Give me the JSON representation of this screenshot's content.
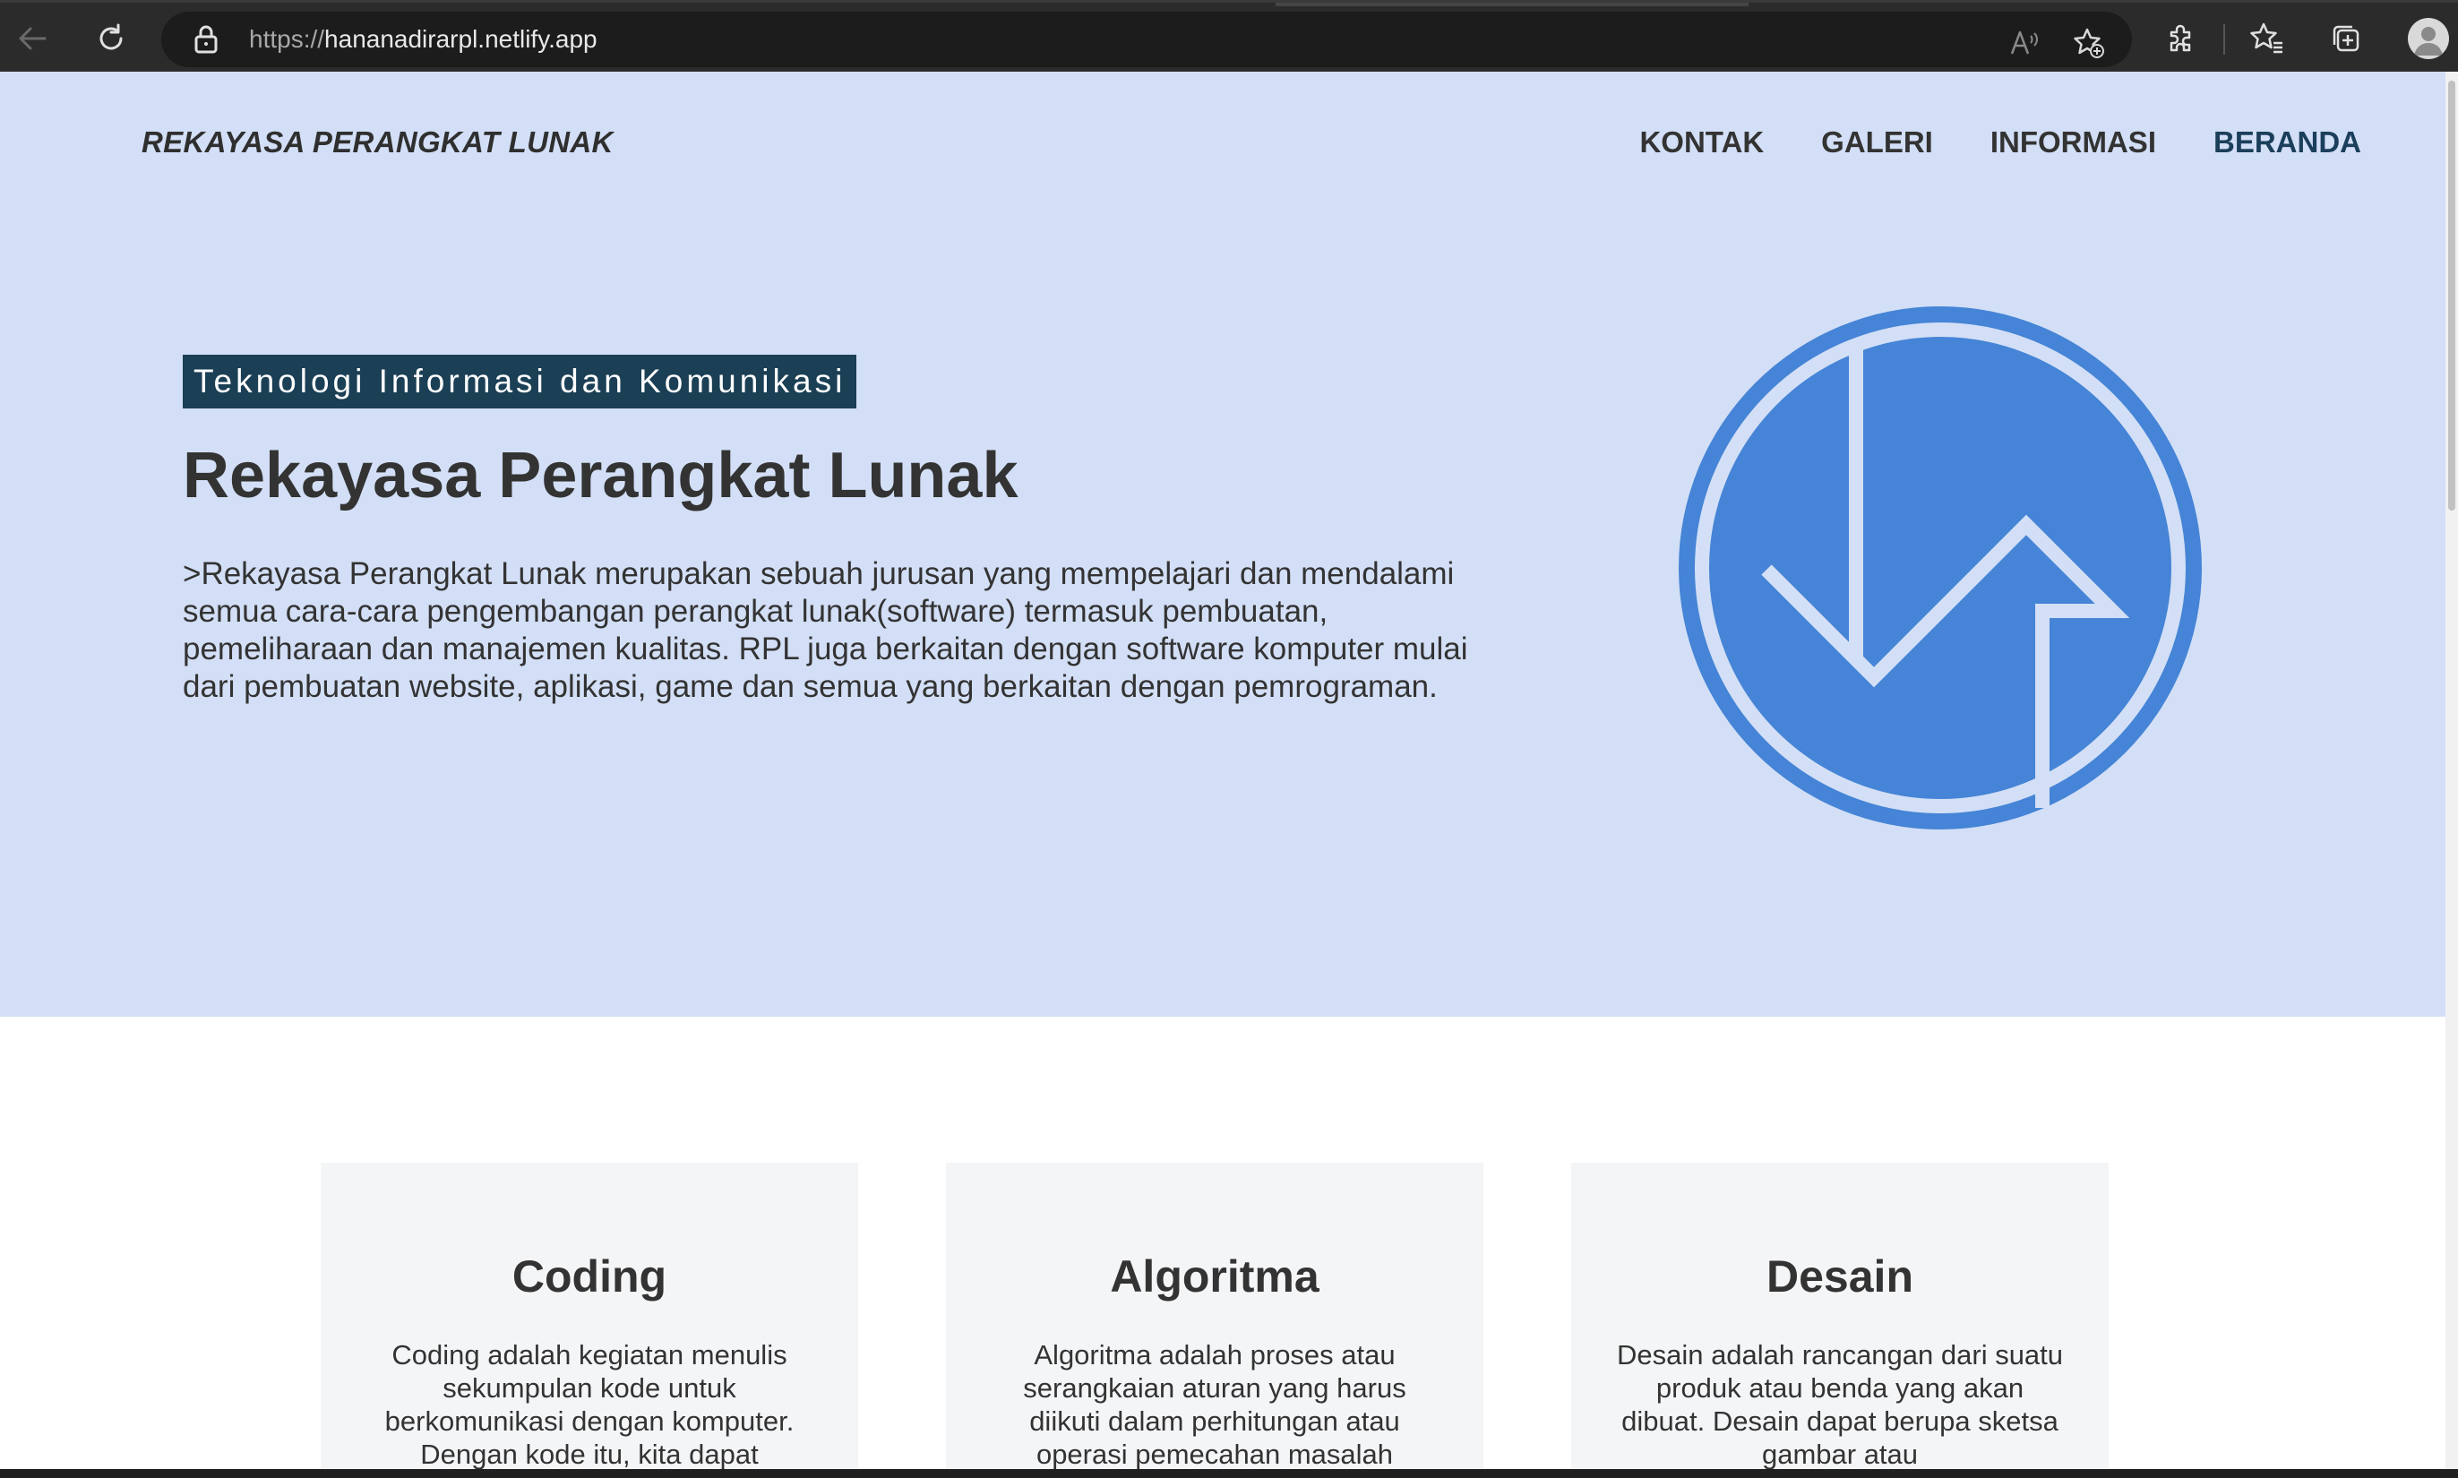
{
  "browser": {
    "url_protocol": "https://",
    "url_host": "hananadirarpl.netlify.app"
  },
  "site": {
    "brand": "REKAYASA PERANGKAT LUNAK",
    "nav": [
      "KONTAK",
      "GALERI",
      "INFORMASI",
      "BERANDA"
    ],
    "active_nav": "BERANDA"
  },
  "hero": {
    "tag": "Teknologi Informasi dan Komunikasi",
    "title": "Rekayasa Perangkat Lunak",
    "description": ">Rekayasa Perangkat Lunak merupakan sebuah jurusan yang mempelajari dan mendalami semua cara-cara pengembangan perangkat lunak(software) termasuk pembuatan, pemeliharaan dan manajemen kualitas. RPL juga berkaitan dengan software komputer mulai dari pembuatan website, aplikasi, game dan semua yang berkaitan dengan pemrograman."
  },
  "cards": [
    {
      "title": "Coding",
      "text": "Coding adalah kegiatan menulis sekumpulan kode untuk berkomunikasi dengan komputer. Dengan kode itu, kita dapat"
    },
    {
      "title": "Algoritma",
      "text": "Algoritma adalah proses atau serangkaian aturan yang harus diikuti dalam perhitungan atau operasi pemecahan masalah"
    },
    {
      "title": "Desain",
      "text": "Desain adalah rancangan dari suatu produk atau benda yang akan dibuat. Desain dapat berupa sketsa gambar atau"
    }
  ],
  "colors": {
    "hero_bg": "#d3dff6",
    "tag_bg": "#1b3f55",
    "logo_blue": "#4584d6",
    "card_bg": "#f4f5f7"
  },
  "icons": [
    "back-arrow-icon",
    "refresh-icon",
    "lock-icon",
    "read-aloud-icon",
    "add-favorite-icon",
    "extensions-icon",
    "favorites-icon",
    "collections-icon",
    "profile-avatar",
    "rpl-logo"
  ]
}
